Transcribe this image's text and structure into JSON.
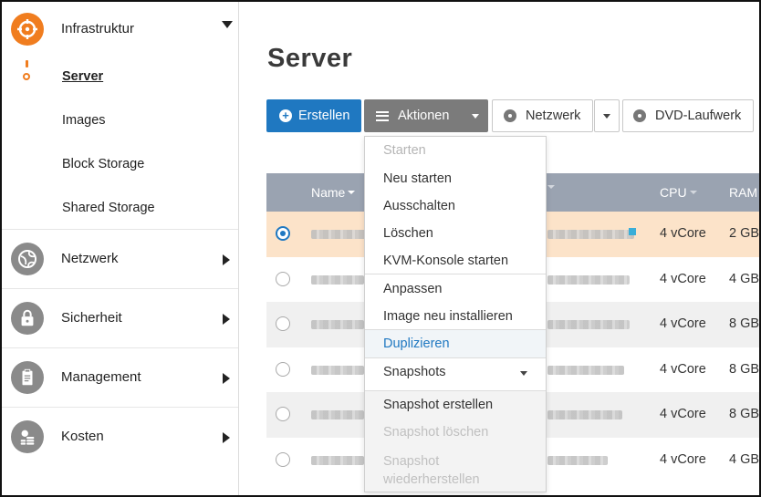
{
  "sidebar": {
    "groups": [
      {
        "label": "Infrastruktur",
        "icon": "infrastructure-icon",
        "expanded": true
      },
      {
        "label": "Netzwerk",
        "icon": "network-globe-icon"
      },
      {
        "label": "Sicherheit",
        "icon": "lock-icon"
      },
      {
        "label": "Management",
        "icon": "clipboard-icon"
      },
      {
        "label": "Kosten",
        "icon": "coins-icon"
      }
    ],
    "subitems": [
      {
        "label": "Server",
        "active": true
      },
      {
        "label": "Images"
      },
      {
        "label": "Block Storage"
      },
      {
        "label": "Shared Storage"
      }
    ]
  },
  "page": {
    "title": "Server"
  },
  "toolbar": {
    "create": "Erstellen",
    "actions": "Aktionen",
    "network": "Netzwerk",
    "dvd": "DVD-Laufwerk"
  },
  "table": {
    "columns": {
      "name": "Name",
      "cpu": "CPU",
      "ram": "RAM"
    },
    "rows": [
      {
        "cpu": "4 vCore",
        "ram": "2 GB",
        "selected": true
      },
      {
        "cpu": "4 vCore",
        "ram": "4 GB"
      },
      {
        "cpu": "4 vCore",
        "ram": "8 GB"
      },
      {
        "cpu": "4 vCore",
        "ram": "8 GB"
      },
      {
        "cpu": "4 vCore",
        "ram": "8 GB"
      },
      {
        "cpu": "4 vCore",
        "ram": "4 GB"
      }
    ]
  },
  "menu": {
    "items": [
      {
        "label": "Starten",
        "state": "disabled"
      },
      {
        "label": "Neu starten"
      },
      {
        "label": "Ausschalten"
      },
      {
        "label": "Löschen"
      },
      {
        "label": "KVM-Konsole starten"
      },
      {
        "label": "Anpassen"
      },
      {
        "label": "Image neu installieren"
      },
      {
        "label": "Duplizieren",
        "state": "hover"
      },
      {
        "label": "Snapshots"
      }
    ],
    "snapshot_sub": [
      {
        "label": "Snapshot erstellen"
      },
      {
        "label": "Snapshot löschen",
        "state": "disabled"
      },
      {
        "label": "Snapshot wiederherstellen",
        "state": "disabled"
      }
    ]
  },
  "colors": {
    "accent": "#f07d1f",
    "primary": "#1f78c1",
    "header": "#9aa3b1",
    "selected_row": "#fce3c9"
  }
}
